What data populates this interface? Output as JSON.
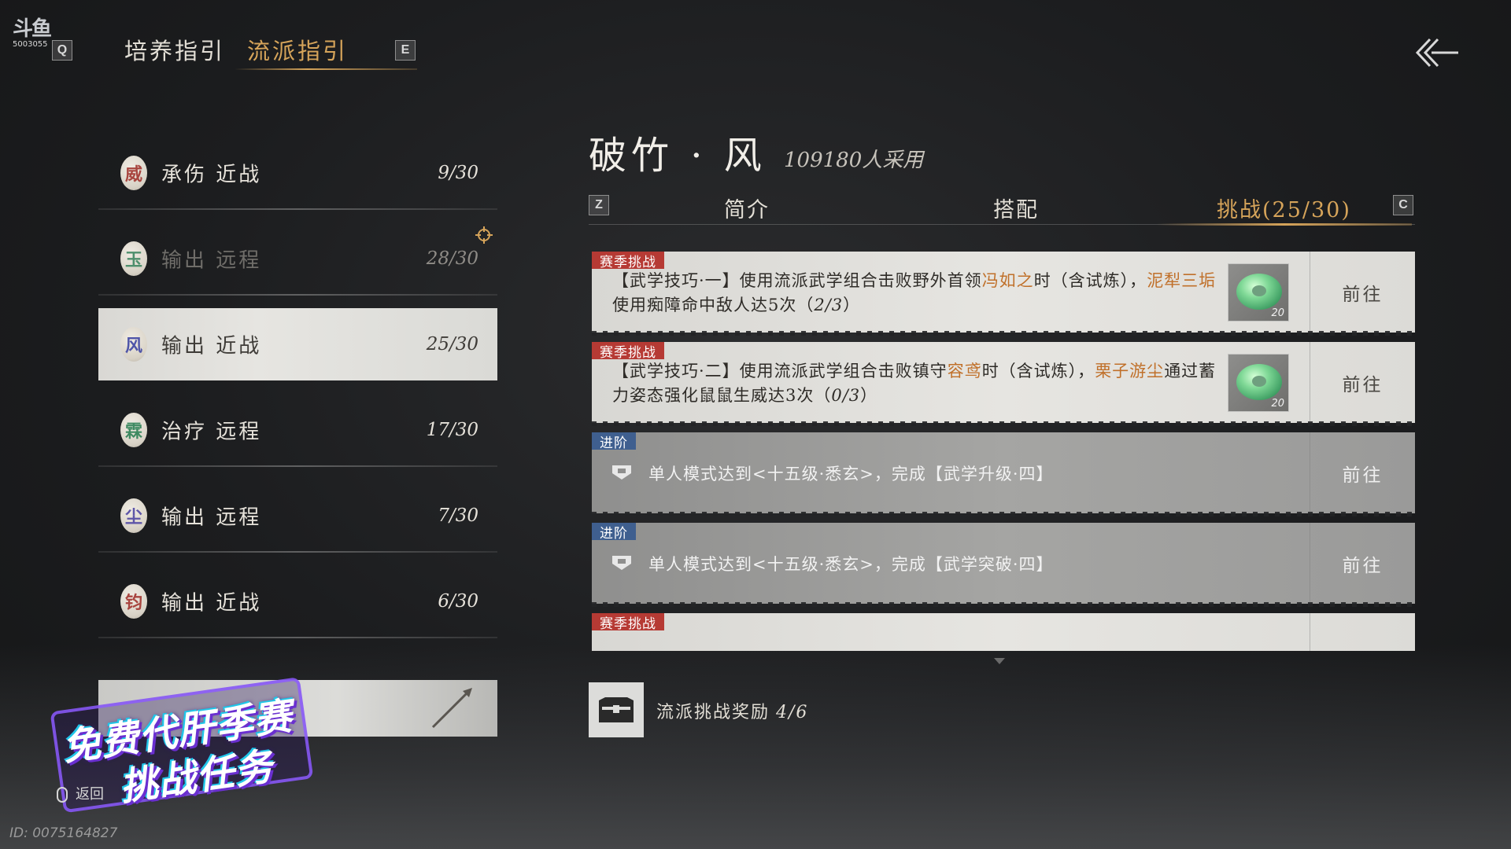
{
  "logo": {
    "mark": "斗鱼",
    "room_id": "5003055"
  },
  "top_tabs": [
    {
      "key": "Q",
      "label": "培养指引"
    },
    {
      "key": "",
      "label": "流派指引"
    },
    {
      "key": "E",
      "label": ""
    }
  ],
  "schools": [
    {
      "seal": "威",
      "label": "承伤 近战",
      "count": "9/30",
      "seal_color": "#a8453f"
    },
    {
      "seal": "玉",
      "label": "输出 远程",
      "count": "28/30",
      "seal_color": "#4e8f6d"
    },
    {
      "seal": "风",
      "label": "输出 近战",
      "count": "25/30",
      "seal_color": "#4f55a8"
    },
    {
      "seal": "霖",
      "label": "治疗 远程",
      "count": "17/30",
      "seal_color": "#3f8a62"
    },
    {
      "seal": "尘",
      "label": "输出 远程",
      "count": "7/30",
      "seal_color": "#5e56a8"
    },
    {
      "seal": "钧",
      "label": "输出 近战",
      "count": "6/30",
      "seal_color": "#a8453f"
    }
  ],
  "promo": {
    "line1": "免费代肝季赛",
    "line2": "挑战任务"
  },
  "return_label": "返回",
  "footer_id": "ID: 0075164827",
  "detail": {
    "title": "破竹 · 风",
    "adopt": "109180人采用",
    "tab_key_left": "Z",
    "tab_key_right": "C",
    "tabs": [
      "简介",
      "搭配",
      "挑战(25/30)"
    ]
  },
  "tasks": [
    {
      "type": "season",
      "tag": "赛季挑战",
      "parts": [
        "【武学技巧·一】使用流派武学组合击败野外首领",
        "冯如之",
        "时（含试炼），",
        "泥犁三垢",
        "使用痴障命中敌人达5次（",
        "2/3",
        "）"
      ],
      "reward_qty": "20",
      "go": "前往"
    },
    {
      "type": "season",
      "tag": "赛季挑战",
      "parts": [
        "【武学技巧·二】使用流派武学组合击败镇守",
        "容鸢",
        "时（含试炼），",
        "栗子游尘",
        "通过蓄力姿态强化鼠鼠生威达3次（",
        "0/3",
        "）"
      ],
      "reward_qty": "20",
      "go": "前往"
    },
    {
      "type": "advance",
      "tag": "进阶",
      "desc": "单人模式达到<十五级·悉玄>，完成【武学升级·四】",
      "go": "前往"
    },
    {
      "type": "advance",
      "tag": "进阶",
      "desc": "单人模式达到<十五级·悉玄>，完成【武学突破·四】",
      "go": "前往"
    },
    {
      "type": "season",
      "tag": "赛季挑战",
      "parts": [
        "",
        "",
        "",
        "",
        "",
        "",
        ""
      ],
      "reward_qty": "",
      "go": ""
    }
  ],
  "reward_bar": {
    "label": "流派挑战奖励",
    "progress": "4/6"
  },
  "colors": {
    "accent_gold": "#d6a45a",
    "tag_red": "#b63a34",
    "tag_blue": "#3f5f8f",
    "highlight_orange": "#c0702a"
  }
}
